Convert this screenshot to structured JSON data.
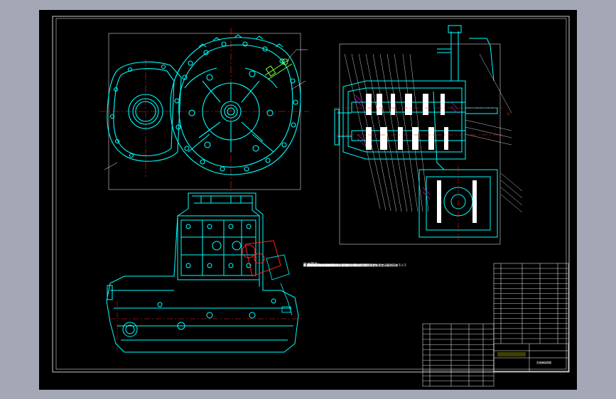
{
  "app": {
    "window_title": ""
  },
  "sheet": {
    "background": "#000000",
    "frame_color": "#ffffff",
    "paper_color": "#a3a7b6"
  },
  "colors": {
    "cyan": "#00ffff",
    "white": "#ffffff",
    "red": "#ff2020",
    "green": "#80ff40",
    "magenta": "#ff00ff"
  },
  "views": [
    {
      "name": "front-view",
      "description_icon": "gearbox-housing-front"
    },
    {
      "name": "side-view",
      "description_icon": "gearbox-housing-side"
    },
    {
      "name": "section-view",
      "description_icon": "gearbox-section"
    }
  ],
  "notes": {
    "title": "技术要求：",
    "lines": [
      "1. 装配前，所有零件用煤油，清洗并吹干擦拭干净。",
      "2. 装配前，检查各零件尺寸误差（F），Δ≤。",
      "3. 装配好后检查齿轮啮合侧隙及接触斑点，应符合技术要求规定，接触斑点不小于",
      "长、齿高的%，齿长的%以上（此项检验需在负荷下）。",
      "4. 各轴承安装后应转动灵活，游隙。",
      "5. 变速器箱体结合面、各接合面允许涂密封胶，但不允许有任何填料（只有",
      "用必要时，允许涂密封胶）。",
      "6. 装配后用  冷油或润滑油检验，并由 MR 油泵检查密封性。",
      "7. 壳体表面涂防锈漆。"
    ]
  },
  "bom_right": {
    "rows": 16
  },
  "bom_left": {
    "rows": 12
  },
  "title_block": {
    "label": "变速器装配图"
  },
  "callout_marker": "11"
}
